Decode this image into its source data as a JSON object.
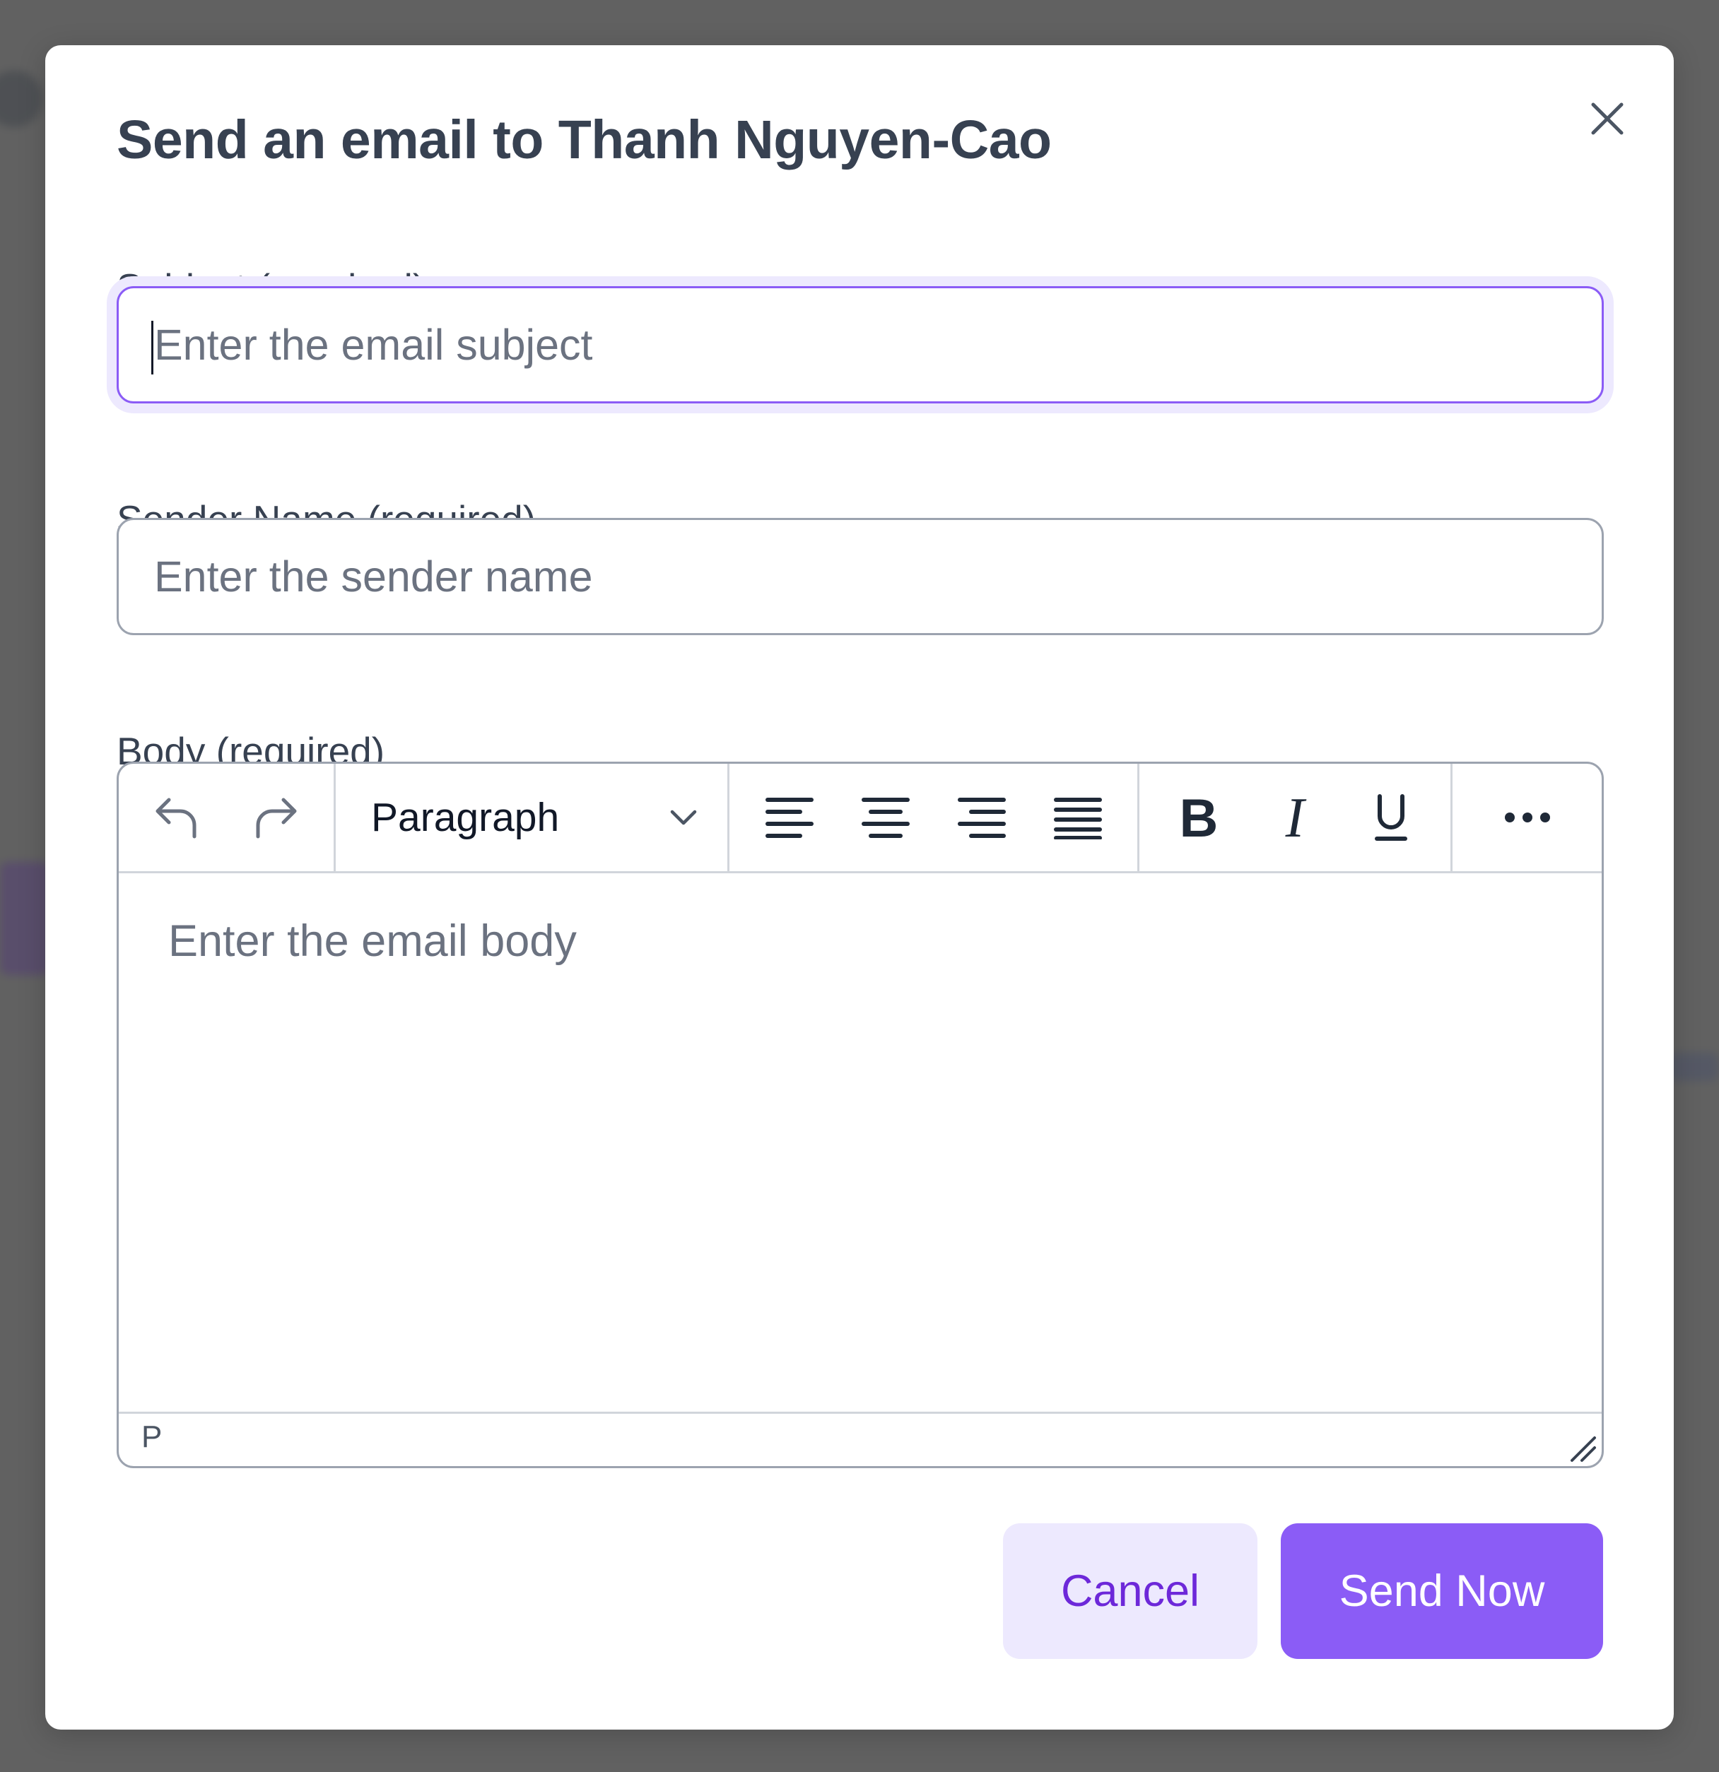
{
  "modal": {
    "title": "Send an email to Thanh Nguyen-Cao",
    "close_icon": "close-icon"
  },
  "subject": {
    "label": "Subject (required)",
    "value": "",
    "placeholder": "Enter the email subject"
  },
  "sender": {
    "label": "Sender Name (required)",
    "value": "",
    "placeholder": "Enter the sender name"
  },
  "body": {
    "label": "Body (required)",
    "placeholder": "Enter the email body",
    "status_path": "P",
    "toolbar": {
      "history": [
        "undo-icon",
        "redo-icon"
      ],
      "block_format": "Paragraph",
      "alignment": [
        "align-left-icon",
        "align-center-icon",
        "align-right-icon",
        "align-justify-icon"
      ],
      "formatting": [
        "bold-icon",
        "italic-icon",
        "underline-icon"
      ],
      "more": "more-icon"
    }
  },
  "actions": {
    "cancel_label": "Cancel",
    "send_label": "Send Now"
  },
  "colors": {
    "accent": "#8b5cf6",
    "accent_light": "#ede9fe",
    "accent_text": "#6d28d9",
    "title_text": "#374151",
    "border": "#9ca3af"
  }
}
